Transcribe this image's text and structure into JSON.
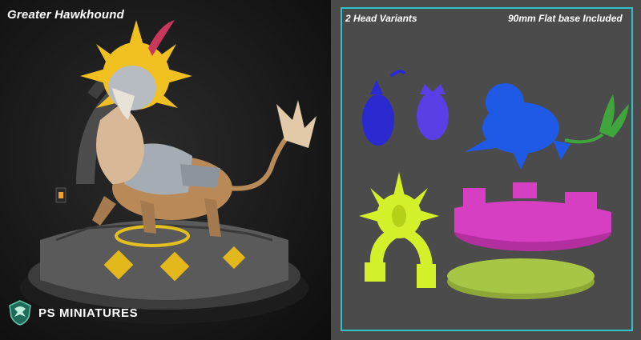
{
  "left_panel": {
    "title": "Greater Hawkhound",
    "brand": {
      "name": "PS MINIATURES",
      "logo_icon": "dragon-shield-logo"
    }
  },
  "right_panel": {
    "head_variants_label": "2 Head Variants",
    "base_label": "90mm Flat base Included",
    "frame_color": "#2fc3c9",
    "part_colors": {
      "head_variant_a": "#2a2ad0",
      "head_variant_b": "#5a3ee6",
      "body": "#1f5ae6",
      "tail_plume": "#3fa53c",
      "sun_arch": "#d4f02a",
      "ruin_base": "#d63fc2",
      "flat_base": "#a8c646"
    }
  }
}
